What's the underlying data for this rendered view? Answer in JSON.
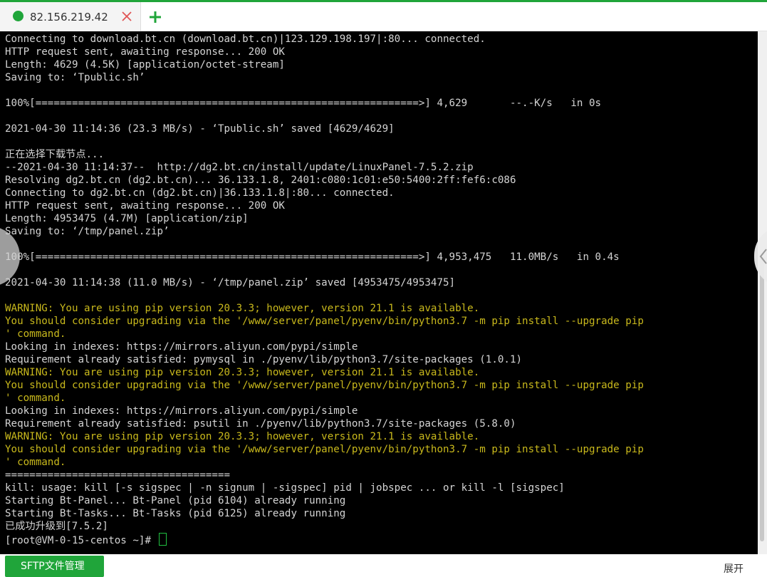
{
  "tab": {
    "title": "82.156.219.42",
    "status_color": "#20a53a",
    "close_icon": "close-icon",
    "add_icon": "plus-icon"
  },
  "terminal": {
    "lines": [
      {
        "text": "Connecting to download.bt.cn (download.bt.cn)|123.129.198.197|:80... connected.",
        "style": "normal"
      },
      {
        "text": "HTTP request sent, awaiting response... 200 OK",
        "style": "normal"
      },
      {
        "text": "Length: 4629 (4.5K) [application/octet-stream]",
        "style": "normal"
      },
      {
        "text": "Saving to: ‘Tpublic.sh’",
        "style": "normal"
      },
      {
        "text": "",
        "style": "normal"
      },
      {
        "text": "100%[===============================================================>] 4,629       --.-K/s   in 0s",
        "style": "normal"
      },
      {
        "text": "",
        "style": "normal"
      },
      {
        "text": "2021-04-30 11:14:36 (23.3 MB/s) - ‘Tpublic.sh’ saved [4629/4629]",
        "style": "normal"
      },
      {
        "text": "",
        "style": "normal"
      },
      {
        "text": "正在选择下载节点...",
        "style": "normal"
      },
      {
        "text": "--2021-04-30 11:14:37--  http://dg2.bt.cn/install/update/LinuxPanel-7.5.2.zip",
        "style": "normal"
      },
      {
        "text": "Resolving dg2.bt.cn (dg2.bt.cn)... 36.133.1.8, 2401:c080:1c01:e50:5400:2ff:fef6:c086",
        "style": "normal"
      },
      {
        "text": "Connecting to dg2.bt.cn (dg2.bt.cn)|36.133.1.8|:80... connected.",
        "style": "normal"
      },
      {
        "text": "HTTP request sent, awaiting response... 200 OK",
        "style": "normal"
      },
      {
        "text": "Length: 4953475 (4.7M) [application/zip]",
        "style": "normal"
      },
      {
        "text": "Saving to: ‘/tmp/panel.zip’",
        "style": "normal"
      },
      {
        "text": "",
        "style": "normal"
      },
      {
        "text": "100%[===============================================================>] 4,953,475   11.0MB/s   in 0.4s",
        "style": "normal"
      },
      {
        "text": "",
        "style": "normal"
      },
      {
        "text": "2021-04-30 11:14:38 (11.0 MB/s) - ‘/tmp/panel.zip’ saved [4953475/4953475]",
        "style": "normal"
      },
      {
        "text": "",
        "style": "normal"
      },
      {
        "text": "WARNING: You are using pip version 20.3.3; however, version 21.1 is available.",
        "style": "warn"
      },
      {
        "text": "You should consider upgrading via the '/www/server/panel/pyenv/bin/python3.7 -m pip install --upgrade pip",
        "style": "warn"
      },
      {
        "text": "' command.",
        "style": "warn"
      },
      {
        "text": "Looking in indexes: https://mirrors.aliyun.com/pypi/simple",
        "style": "normal"
      },
      {
        "text": "Requirement already satisfied: pymysql in ./pyenv/lib/python3.7/site-packages (1.0.1)",
        "style": "normal"
      },
      {
        "text": "WARNING: You are using pip version 20.3.3; however, version 21.1 is available.",
        "style": "warn"
      },
      {
        "text": "You should consider upgrading via the '/www/server/panel/pyenv/bin/python3.7 -m pip install --upgrade pip",
        "style": "warn"
      },
      {
        "text": "' command.",
        "style": "warn"
      },
      {
        "text": "Looking in indexes: https://mirrors.aliyun.com/pypi/simple",
        "style": "normal"
      },
      {
        "text": "Requirement already satisfied: psutil in ./pyenv/lib/python3.7/site-packages (5.8.0)",
        "style": "normal"
      },
      {
        "text": "WARNING: You are using pip version 20.3.3; however, version 21.1 is available.",
        "style": "warn"
      },
      {
        "text": "You should consider upgrading via the '/www/server/panel/pyenv/bin/python3.7 -m pip install --upgrade pip",
        "style": "warn"
      },
      {
        "text": "' command.",
        "style": "warn"
      },
      {
        "text": "=====================================",
        "style": "normal"
      },
      {
        "text": "kill: usage: kill [-s sigspec | -n signum | -sigspec] pid | jobspec ... or kill -l [sigspec]",
        "style": "normal"
      },
      {
        "text": "Starting Bt-Panel... Bt-Panel (pid 6104) already running",
        "style": "normal"
      },
      {
        "text": "Starting Bt-Tasks... Bt-Tasks (pid 6125) already running",
        "style": "normal"
      },
      {
        "text": "已成功升级到[7.5.2]",
        "style": "normal"
      }
    ],
    "prompt": "[root@VM-0-15-centos ~]# ",
    "text_color": "#d4d4d4",
    "warning_color": "#c9b91c",
    "cursor_color": "#20c040"
  },
  "nav": {
    "prev_icon": "chevron-left-icon",
    "next_icon": "chevron-right-icon"
  },
  "footer": {
    "sftp_label": "SFTP文件管理",
    "expand_label": "展开"
  },
  "colors": {
    "accent": "#20a53a",
    "terminal_bg": "#000000"
  }
}
